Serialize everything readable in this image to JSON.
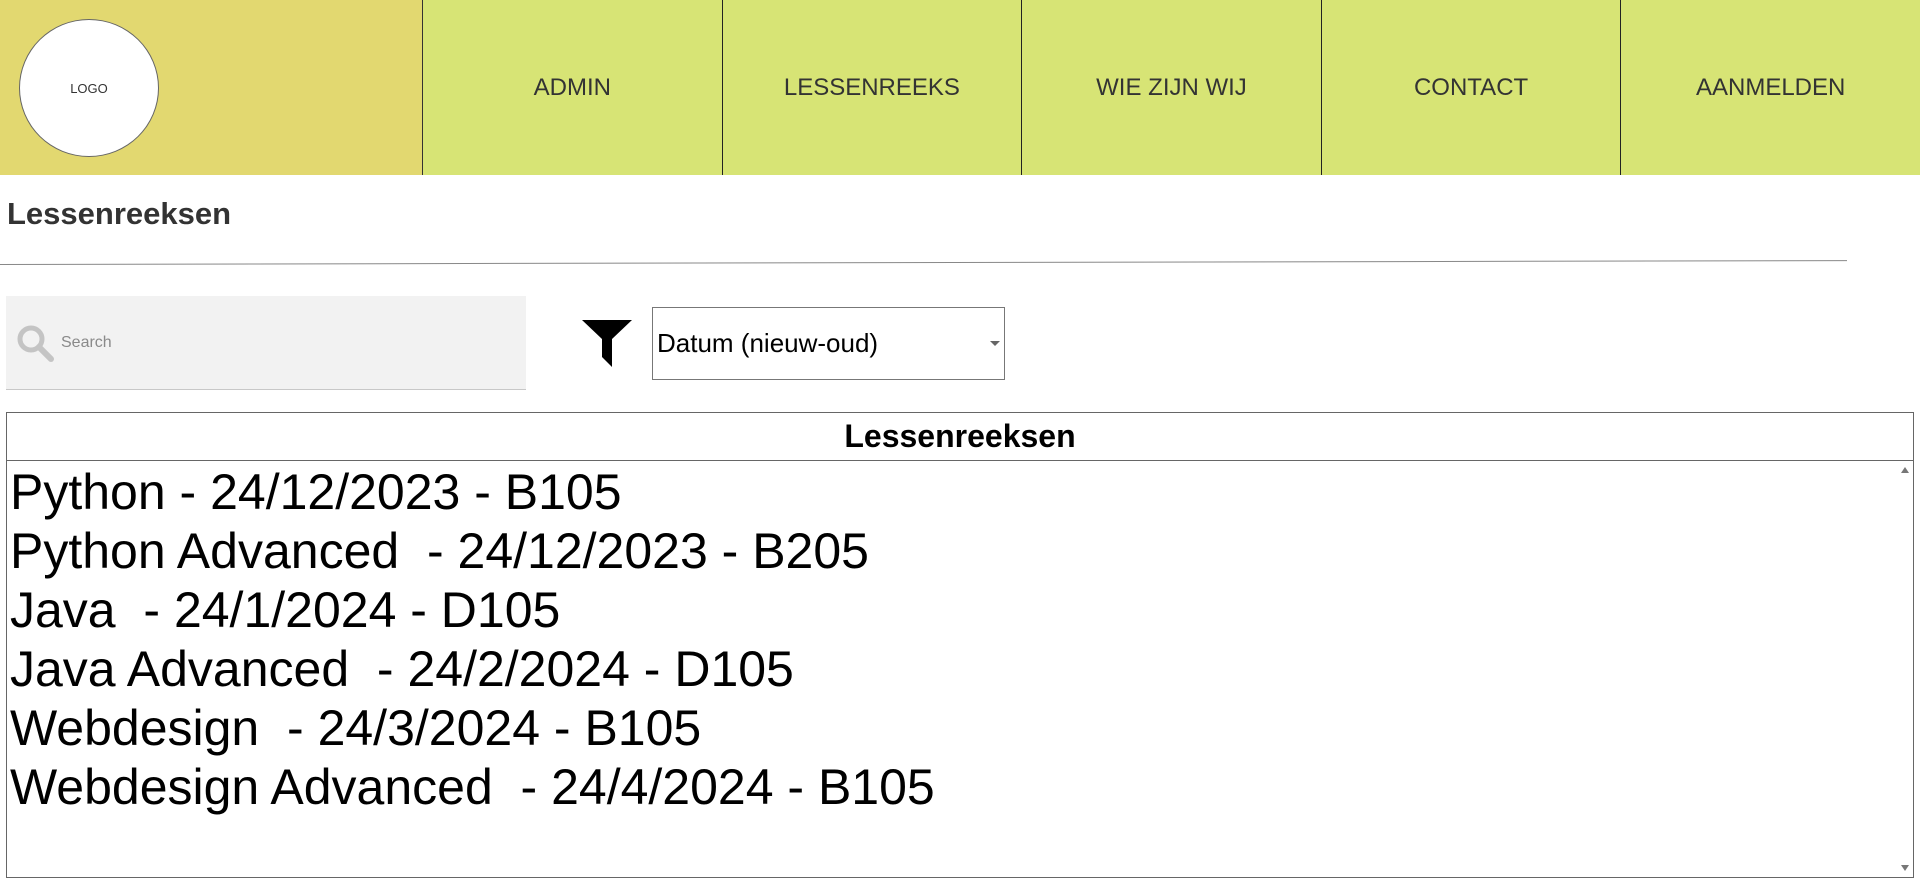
{
  "header": {
    "logo_text": "LOGO",
    "nav": [
      {
        "label": "ADMIN"
      },
      {
        "label": "LESSENREEKS"
      },
      {
        "label": "WIE ZIJN WIJ"
      },
      {
        "label": "CONTACT"
      },
      {
        "label": "AANMELDEN"
      }
    ]
  },
  "page": {
    "title": "Lessenreeksen"
  },
  "search": {
    "placeholder": "Search",
    "icon": "search-icon"
  },
  "filter": {
    "icon": "filter-icon",
    "selected": "Datum (nieuw-oud)"
  },
  "list": {
    "header": "Lessenreeksen",
    "items": [
      "Python - 24/12/2023 - B105",
      "Python Advanced  - 24/12/2023 - B205",
      "Java  - 24/1/2024 - D105",
      "Java Advanced  - 24/2/2024 - D105",
      "Webdesign  - 24/3/2024 - B105",
      "Webdesign Advanced  - 24/4/2024 - B105"
    ]
  },
  "colors": {
    "logo_bg": "#e2d870",
    "nav_bg": "#d7e475",
    "search_bg": "#f2f2f2"
  }
}
